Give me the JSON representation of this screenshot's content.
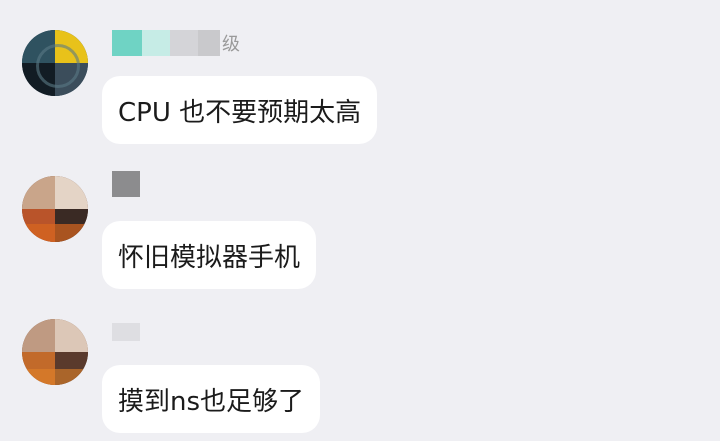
{
  "messages": [
    {
      "sender_tag": "级",
      "text": "CPU 也不要预期太高"
    },
    {
      "sender_tag": "",
      "text": "怀旧模拟器手机"
    },
    {
      "sender_tag": "",
      "text": "摸到ns也足够了"
    }
  ]
}
